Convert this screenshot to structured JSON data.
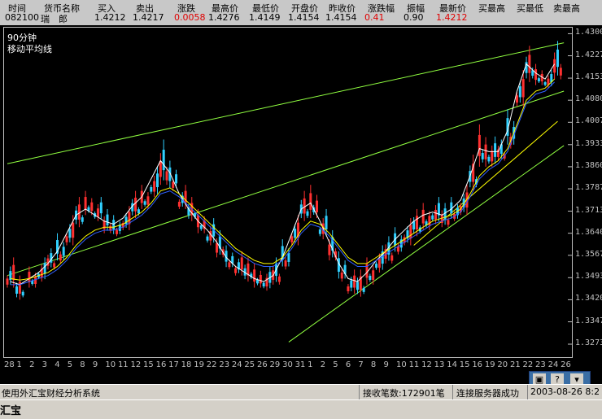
{
  "quote": {
    "headers": [
      "时间",
      "货币名称",
      "买入",
      "卖出",
      "涨跌",
      "最高价",
      "最低价",
      "开盘价",
      "昨收价",
      "涨跌幅",
      "振幅",
      "最新价",
      "买最高",
      "买最低",
      "卖最高"
    ],
    "values": [
      "082100",
      "瑞　郎",
      "1.4212",
      "1.4217",
      "0.0058",
      "1.4276",
      "1.4149",
      "1.4154",
      "1.4154",
      "0.41",
      "0.90",
      "1.4212",
      "",
      "",
      ""
    ]
  },
  "chart": {
    "period": "90分钟",
    "indicator": "移动平均线"
  },
  "chart_data": {
    "type": "line",
    "title": "",
    "yticks": [
      "1.4300",
      "1.4227",
      "1.4153",
      "1.4080",
      "1.4007",
      "1.3933",
      "1.3860",
      "1.3787",
      "1.3713",
      "1.3640",
      "1.3567",
      "1.3493",
      "1.3420",
      "1.3347",
      "1.3273"
    ],
    "ylim": [
      1.323,
      1.432
    ],
    "xticks": [
      "28",
      "1",
      "2",
      "3",
      "4",
      "5",
      "8",
      "9",
      "10",
      "11",
      "12",
      "15",
      "16",
      "17",
      "18",
      "19",
      "22",
      "23",
      "24",
      "25",
      "26",
      "29",
      "30",
      "31",
      "1",
      "2",
      "5",
      "6",
      "7",
      "8",
      "9",
      "10",
      "11",
      "12",
      "13",
      "14",
      "15",
      "16",
      "19",
      "20",
      "21",
      "22",
      "23",
      "24",
      "26"
    ],
    "candles": [
      [
        0,
        1.356,
        1.346
      ],
      [
        3,
        1.35,
        1.342
      ],
      [
        7,
        1.353,
        1.346
      ],
      [
        10,
        1.356,
        1.348
      ],
      [
        13,
        1.359,
        1.352
      ],
      [
        16,
        1.364,
        1.354
      ],
      [
        19,
        1.37,
        1.36
      ],
      [
        22,
        1.376,
        1.366
      ],
      [
        25,
        1.378,
        1.37
      ],
      [
        28,
        1.376,
        1.368
      ],
      [
        31,
        1.372,
        1.364
      ],
      [
        34,
        1.37,
        1.363
      ],
      [
        37,
        1.373,
        1.365
      ],
      [
        40,
        1.378,
        1.369
      ],
      [
        43,
        1.38,
        1.372
      ],
      [
        46,
        1.386,
        1.376
      ],
      [
        49,
        1.395,
        1.38
      ],
      [
        52,
        1.388,
        1.378
      ],
      [
        55,
        1.38,
        1.372
      ],
      [
        58,
        1.376,
        1.368
      ],
      [
        61,
        1.372,
        1.364
      ],
      [
        64,
        1.369,
        1.36
      ],
      [
        67,
        1.365,
        1.356
      ],
      [
        70,
        1.36,
        1.352
      ],
      [
        73,
        1.358,
        1.35
      ],
      [
        76,
        1.356,
        1.348
      ],
      [
        79,
        1.354,
        1.346
      ],
      [
        82,
        1.353,
        1.345
      ],
      [
        85,
        1.356,
        1.347
      ],
      [
        88,
        1.362,
        1.352
      ],
      [
        91,
        1.37,
        1.36
      ],
      [
        94,
        1.378,
        1.368
      ],
      [
        97,
        1.38,
        1.369
      ],
      [
        100,
        1.372,
        1.362
      ],
      [
        103,
        1.365,
        1.355
      ],
      [
        106,
        1.358,
        1.348
      ],
      [
        109,
        1.352,
        1.344
      ],
      [
        112,
        1.352,
        1.343
      ],
      [
        115,
        1.356,
        1.347
      ],
      [
        118,
        1.36,
        1.351
      ],
      [
        121,
        1.363,
        1.354
      ],
      [
        124,
        1.366,
        1.357
      ],
      [
        127,
        1.369,
        1.36
      ],
      [
        130,
        1.372,
        1.363
      ],
      [
        133,
        1.374,
        1.365
      ],
      [
        136,
        1.376,
        1.367
      ],
      [
        139,
        1.374,
        1.366
      ],
      [
        142,
        1.376,
        1.368
      ],
      [
        145,
        1.38,
        1.37
      ],
      [
        148,
        1.39,
        1.378
      ],
      [
        151,
        1.4,
        1.386
      ],
      [
        154,
        1.396,
        1.386
      ],
      [
        157,
        1.395,
        1.388
      ],
      [
        160,
        1.405,
        1.392
      ],
      [
        163,
        1.418,
        1.406
      ],
      [
        166,
        1.426,
        1.414
      ],
      [
        169,
        1.42,
        1.413
      ],
      [
        172,
        1.418,
        1.412
      ],
      [
        175,
        1.4276,
        1.4149
      ]
    ],
    "ma_series": [
      {
        "color": "#ffffff",
        "values": [
          1.348,
          1.347,
          1.349,
          1.351,
          1.354,
          1.358,
          1.364,
          1.37,
          1.372,
          1.37,
          1.368,
          1.367,
          1.369,
          1.373,
          1.376,
          1.382,
          1.388,
          1.384,
          1.377,
          1.372,
          1.368,
          1.365,
          1.361,
          1.356,
          1.353,
          1.351,
          1.349,
          1.348,
          1.35,
          1.356,
          1.364,
          1.372,
          1.374,
          1.368,
          1.361,
          1.354,
          1.349,
          1.348,
          1.351,
          1.355,
          1.358,
          1.362,
          1.365,
          1.368,
          1.37,
          1.371,
          1.37,
          1.372,
          1.375,
          1.383,
          1.392,
          1.391,
          1.391,
          1.398,
          1.411,
          1.42,
          1.417,
          1.415,
          1.42
        ]
      },
      {
        "color": "#ffff00",
        "values": [
          1.349,
          1.3485,
          1.349,
          1.35,
          1.351,
          1.353,
          1.356,
          1.36,
          1.363,
          1.365,
          1.366,
          1.366,
          1.367,
          1.369,
          1.371,
          1.374,
          1.378,
          1.379,
          1.377,
          1.374,
          1.371,
          1.368,
          1.365,
          1.362,
          1.359,
          1.357,
          1.355,
          1.354,
          1.354,
          1.356,
          1.36,
          1.365,
          1.368,
          1.367,
          1.364,
          1.36,
          1.356,
          1.354,
          1.354,
          1.356,
          1.358,
          1.36,
          1.362,
          1.364,
          1.366,
          1.368,
          1.369,
          1.37,
          1.372,
          1.377,
          1.383,
          1.386,
          1.388,
          1.392,
          1.4,
          1.408,
          1.411,
          1.412,
          1.415
        ]
      },
      {
        "color": "#3060ff",
        "values": [
          1.347,
          1.347,
          1.348,
          1.349,
          1.35,
          1.352,
          1.355,
          1.359,
          1.362,
          1.364,
          1.365,
          1.365,
          1.366,
          1.368,
          1.37,
          1.373,
          1.377,
          1.378,
          1.376,
          1.373,
          1.37,
          1.367,
          1.364,
          1.361,
          1.358,
          1.356,
          1.354,
          1.353,
          1.353,
          1.355,
          1.359,
          1.364,
          1.367,
          1.366,
          1.363,
          1.359,
          1.355,
          1.353,
          1.353,
          1.355,
          1.357,
          1.359,
          1.361,
          1.363,
          1.365,
          1.367,
          1.368,
          1.369,
          1.371,
          1.376,
          1.382,
          1.385,
          1.387,
          1.391,
          1.399,
          1.407,
          1.41,
          1.411,
          1.414
        ]
      }
    ],
    "trendlines": [
      {
        "color": "#90ff40",
        "from": [
          0,
          1.387
        ],
        "to": [
          178,
          1.427
        ]
      },
      {
        "color": "#90ff40",
        "from": [
          0,
          1.35
        ],
        "to": [
          178,
          1.411
        ]
      },
      {
        "color": "#90ff40",
        "from": [
          90,
          1.328
        ],
        "to": [
          178,
          1.393
        ]
      },
      {
        "color": "#ffff00",
        "from": [
          130,
          1.36
        ],
        "to": [
          176,
          1.401
        ]
      }
    ],
    "n_slots": 180
  },
  "status": {
    "left": "使用外汇宝财经分析系统",
    "received_label": "接收笔数:172901笔",
    "connection": "连接服务器成功",
    "datetime": "2003-08-26  8:2"
  },
  "taskbar": {
    "title": "汇宝"
  },
  "mini_controls": {
    "help": "?",
    "icon_a": "▣",
    "icon_c": "▾"
  }
}
